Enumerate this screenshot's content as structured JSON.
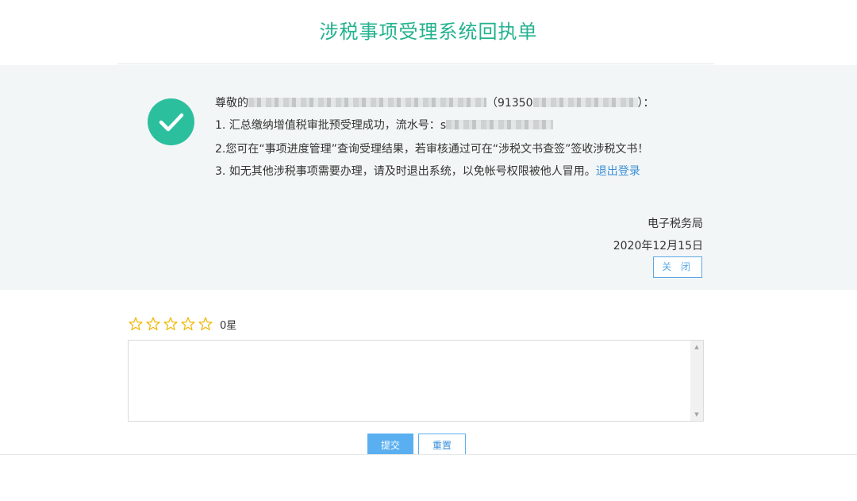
{
  "header": {
    "title": "涉税事项受理系统回执单"
  },
  "receipt": {
    "salutation_prefix": "尊敬的",
    "salutation_taxid_open": "（91350",
    "salutation_close": "）：",
    "line1_prefix": "1. 汇总缴纳增值税审批预受理成功，流水号：",
    "line1_serial_visible": "s",
    "line2": "2.您可在“事项进度管理”查询受理结果，若审核通过可在“涉税文书查签”签收涉税文书！",
    "line3_text": "3. 如无其他涉税事项需要办理，请及时退出系统，以免帐号权限被他人冒用。",
    "logout_link": "退出登录",
    "issuer": "电子税务局",
    "date": "2020年12月15日",
    "close_button": "关 闭"
  },
  "feedback": {
    "stars_total": 5,
    "rating_label": "0星",
    "comment_value": "",
    "submit_button": "提交",
    "reset_button": "重置"
  },
  "colors": {
    "title": "#23b28e",
    "check_badge": "#2cbf9e",
    "panel_bg": "#f3f6f6",
    "link": "#3b8fd8",
    "star": "#f2b600",
    "primary_button": "#5aaff0"
  },
  "icons": {
    "status": "check-circle-icon",
    "rating": "star-outline-icon"
  }
}
